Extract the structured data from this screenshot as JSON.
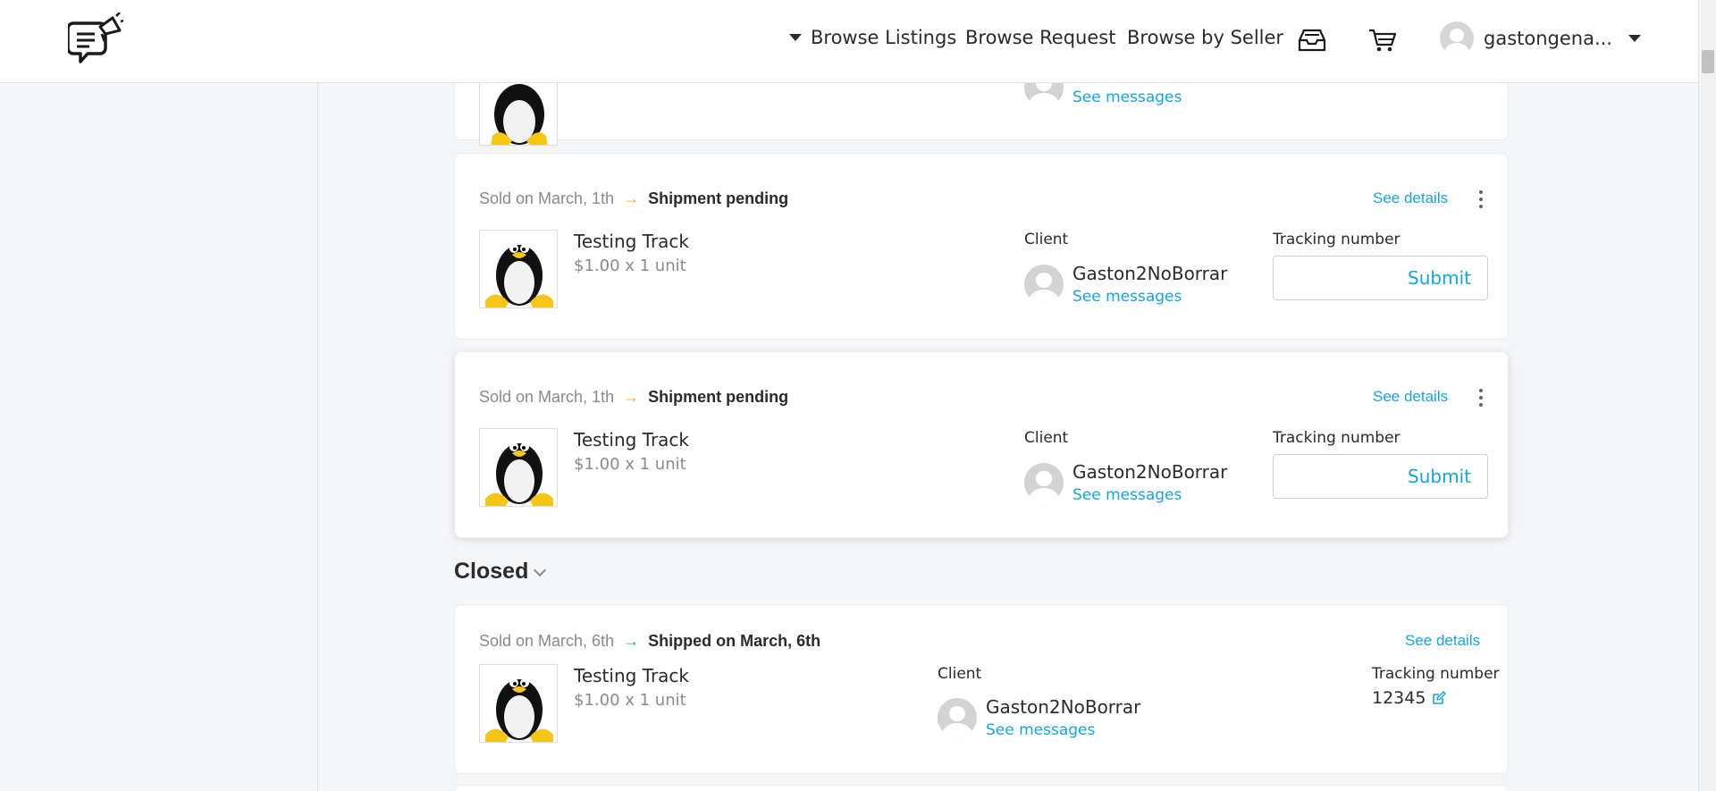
{
  "header": {
    "nav": {
      "browse_listings": "Browse Listings",
      "browse_request": "Browse Request",
      "browse_by_seller": "Browse by Seller"
    },
    "user": {
      "name": "gastongena..."
    },
    "icons": {
      "logo": "chat-megaphone-logo",
      "inbox": "inbox-icon",
      "cart": "cart-icon"
    }
  },
  "orders": [
    {
      "see_messages": "See messages"
    },
    {
      "sold": "Sold on March, 1th",
      "status": "Shipment pending",
      "see_details": "See details",
      "product": {
        "name": "Testing Track",
        "price": "$1.00 x 1 unit"
      },
      "client_label": "Client",
      "client_name": "Gaston2NoBorrar",
      "see_messages": "See messages",
      "tracking_label": "Tracking number",
      "submit": "Submit"
    },
    {
      "sold": "Sold on March, 1th",
      "status": "Shipment pending",
      "see_details": "See details",
      "product": {
        "name": "Testing Track",
        "price": "$1.00 x 1 unit"
      },
      "client_label": "Client",
      "client_name": "Gaston2NoBorrar",
      "see_messages": "See messages",
      "tracking_label": "Tracking number",
      "submit": "Submit"
    }
  ],
  "closed": {
    "title": "Closed",
    "orders": [
      {
        "sold": "Sold on March, 6th",
        "status": "Shipped on March, 6th",
        "see_details": "See details",
        "product": {
          "name": "Testing Track",
          "price": "$1.00 x 1 unit"
        },
        "client_label": "Client",
        "client_name": "Gaston2NoBorrar",
        "see_messages": "See messages",
        "tracking_label": "Tracking number",
        "tracking_value": "12345"
      }
    ]
  },
  "colors": {
    "link": "#1aa3d9",
    "pending_arrow": "#f5a623",
    "shipped_arrow": "#27ae60"
  }
}
